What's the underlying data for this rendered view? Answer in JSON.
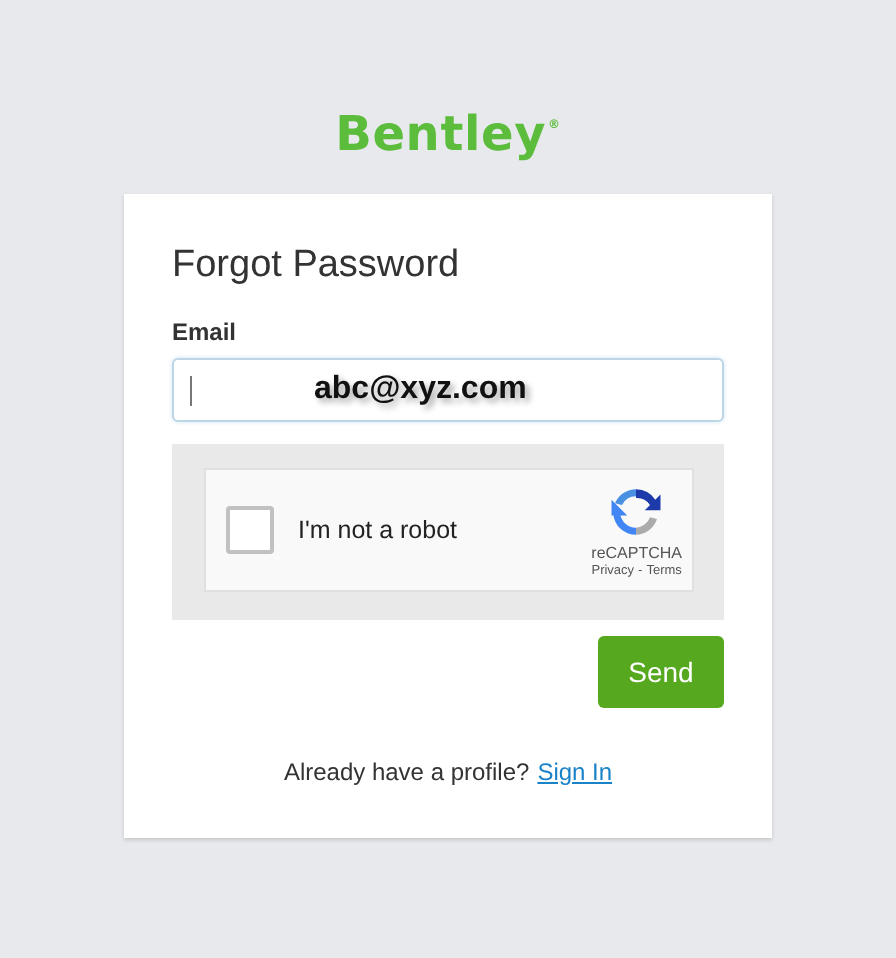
{
  "logo": {
    "text": "Bentley",
    "mark": "®"
  },
  "form": {
    "title": "Forgot Password",
    "email": {
      "label": "Email",
      "annotation": "abc@xyz.com"
    },
    "captcha": {
      "label": "I'm not a robot",
      "checked": false,
      "brand": "reCAPTCHA",
      "privacy": "Privacy",
      "separator": "-",
      "terms": "Terms"
    },
    "button": "Send",
    "footer": {
      "text": "Already have a profile?",
      "link": "Sign In"
    }
  }
}
